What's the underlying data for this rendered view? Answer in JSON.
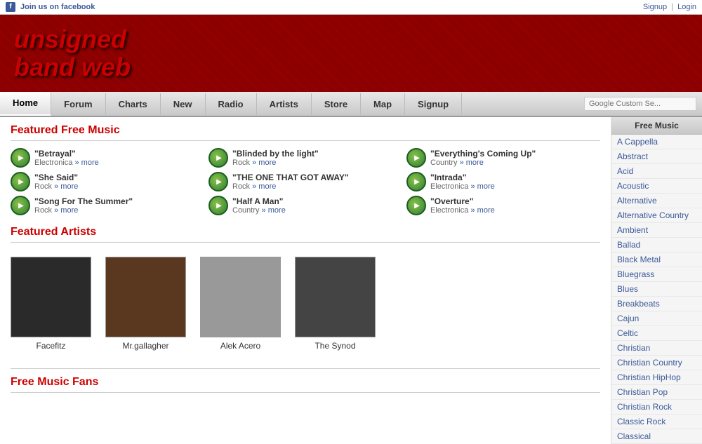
{
  "topbar": {
    "facebook_text": "Join us on facebook",
    "signup_label": "Signup",
    "login_label": "Login",
    "separator": "|"
  },
  "header": {
    "logo_line1": "unsigned",
    "logo_line2": "band web"
  },
  "nav": {
    "items": [
      {
        "label": "Home",
        "active": true
      },
      {
        "label": "Forum",
        "active": false
      },
      {
        "label": "Charts",
        "active": false
      },
      {
        "label": "New",
        "active": false
      },
      {
        "label": "Radio",
        "active": false
      },
      {
        "label": "Artists",
        "active": false
      },
      {
        "label": "Store",
        "active": false
      },
      {
        "label": "Map",
        "active": false
      },
      {
        "label": "Signup",
        "active": false
      }
    ],
    "search_placeholder": "Google Custom Se..."
  },
  "featured_music": {
    "title": "Featured Free Music",
    "items": [
      {
        "title": "\"Betrayal\"",
        "genre": "Electronica",
        "more": "» more"
      },
      {
        "title": "\"Blinded by the light\"",
        "genre": "Rock",
        "more": "» more"
      },
      {
        "title": "\"Everything's Coming Up\"",
        "genre": "Country",
        "more": "» more"
      },
      {
        "title": "\"She Said\"",
        "genre": "Rock",
        "more": "» more"
      },
      {
        "title": "\"THE ONE THAT GOT AWAY\"",
        "genre": "Rock",
        "more": "» more"
      },
      {
        "title": "\"Intrada\"",
        "genre": "Electronica",
        "more": "» more"
      },
      {
        "title": "\"Song For The Summer\"",
        "genre": "Rock",
        "more": "» more"
      },
      {
        "title": "\"Half A Man\"",
        "genre": "Country",
        "more": "» more"
      },
      {
        "title": "\"Overture\"",
        "genre": "Electronica",
        "more": "» more"
      }
    ]
  },
  "featured_artists": {
    "title": "Featured Artists",
    "items": [
      {
        "name": "Facefitz",
        "class": "facefitz"
      },
      {
        "name": "Mr.gallagher",
        "class": "mr-gallagher"
      },
      {
        "name": "Alek Acero",
        "class": "alek-acero"
      },
      {
        "name": "The Synod",
        "class": "the-synod"
      }
    ]
  },
  "free_music_fans": {
    "title": "Free Music Fans"
  },
  "sidebar": {
    "header": "Free Music",
    "items": [
      "A Cappella",
      "Abstract",
      "Acid",
      "Acoustic",
      "Alternative",
      "Alternative Country",
      "Ambient",
      "Ballad",
      "Black Metal",
      "Bluegrass",
      "Blues",
      "Breakbeats",
      "Cajun",
      "Celtic",
      "Christian",
      "Christian Country",
      "Christian HipHop",
      "Christian Pop",
      "Christian Rock",
      "Classic Rock",
      "Classical"
    ]
  }
}
